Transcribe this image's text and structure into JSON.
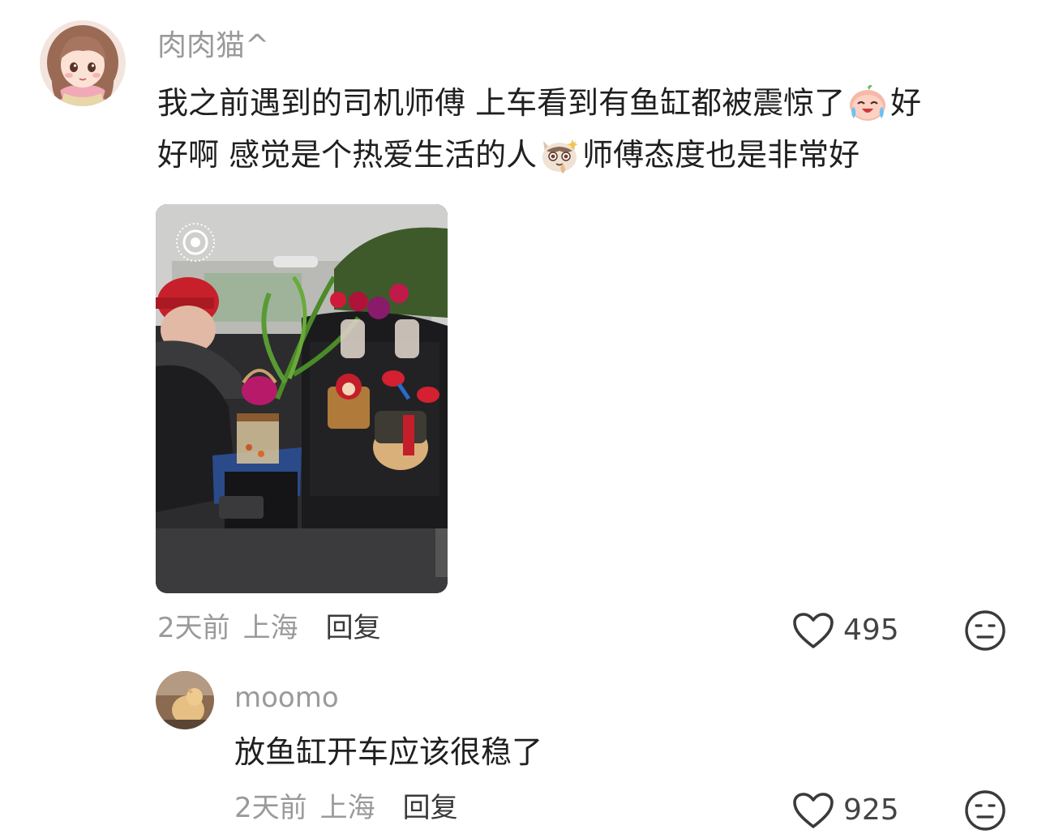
{
  "comments": [
    {
      "username": "肉肉猫^",
      "text_lines": [
        "我之前遇到的司机师傅 上车看到有鱼缸都被震惊了",
        "好",
        "好啊 感觉是个热爱生活的人",
        "师傅态度也是非常好"
      ],
      "emojis": [
        "crying-laughing-peach-emoji",
        "smirking-cat-emoji"
      ],
      "has_live_photo": true,
      "time": "2天前",
      "location": "上海",
      "reply_label": "回复",
      "likes": "495"
    },
    {
      "username": "moomo",
      "text": "放鱼缸开车应该很稳了",
      "time": "2天前",
      "location": "上海",
      "reply_label": "回复",
      "likes": "925"
    }
  ],
  "icons": {
    "like": "heart-outline-icon",
    "dislike": "meh-face-icon",
    "live_photo": "live-photo-icon"
  },
  "colors": {
    "username": "#9a9a9a",
    "text": "#1f1f1f",
    "meta": "#9a9a9a",
    "reply": "#3a3a3a"
  }
}
